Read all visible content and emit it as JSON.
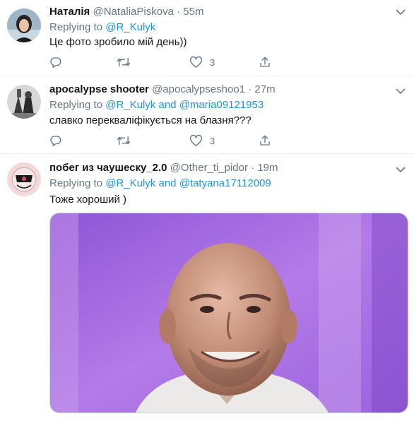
{
  "tweets": [
    {
      "name": "Наталія",
      "handle": "@NataliaPiskova",
      "time": "55m",
      "replying_prefix": "Replying to ",
      "mentions": [
        "@R_Kulyk"
      ],
      "text": "Це фото зробило мій день))",
      "likes": "3"
    },
    {
      "name": "apocalypse shooter",
      "handle": "@apocalypseshoo1",
      "time": "27m",
      "replying_prefix": "Replying to ",
      "mentions": [
        "@R_Kulyk",
        "@maria09121953"
      ],
      "conjunction": " and ",
      "text": "славко перекваліфікується на блазня???",
      "likes": "3"
    },
    {
      "name": "побег из чаушеску_2.0",
      "handle": "@Other_ti_pidor",
      "time": "19m",
      "replying_prefix": "Replying to ",
      "mentions": [
        "@R_Kulyk",
        "@tatyana17112009"
      ],
      "conjunction": " and ",
      "text": "Тоже хороший )"
    }
  ],
  "separator": "·",
  "colors": {
    "link": "#1b95e0",
    "muted": "#657786",
    "text": "#14171a",
    "border": "#e6ecf0",
    "media_purple": "#a46ee0"
  },
  "icons": {
    "reply": "reply-icon",
    "retweet": "retweet-icon",
    "like": "heart-icon",
    "share": "share-icon",
    "more": "chevron-down-icon"
  }
}
